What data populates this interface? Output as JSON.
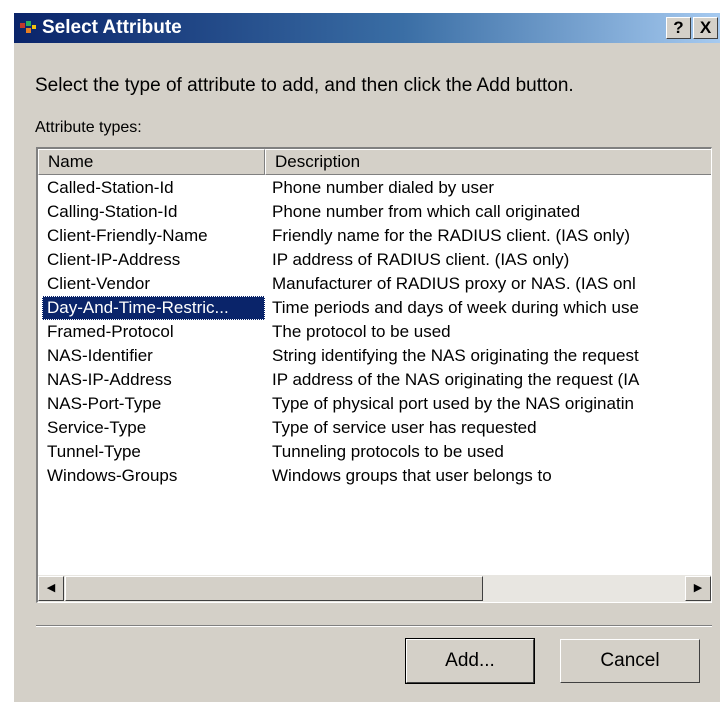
{
  "window": {
    "title": "Select Attribute",
    "help_label": "?",
    "close_label": "X"
  },
  "instruction": "Select the type of attribute to add, and then click the Add button.",
  "list_label": "Attribute types:",
  "columns": {
    "name": "Name",
    "description": "Description"
  },
  "rows": [
    {
      "name": "Called-Station-Id",
      "description": "Phone number dialed by user"
    },
    {
      "name": "Calling-Station-Id",
      "description": "Phone number from which call originated"
    },
    {
      "name": "Client-Friendly-Name",
      "description": "Friendly name for the RADIUS client. (IAS only)"
    },
    {
      "name": "Client-IP-Address",
      "description": "IP address of RADIUS client. (IAS only)"
    },
    {
      "name": "Client-Vendor",
      "description": "Manufacturer of RADIUS proxy or NAS. (IAS onl"
    },
    {
      "name": "Day-And-Time-Restric...",
      "description": "Time periods and days of week during which use"
    },
    {
      "name": "Framed-Protocol",
      "description": "The protocol to be used"
    },
    {
      "name": "NAS-Identifier",
      "description": "String identifying the NAS originating the request"
    },
    {
      "name": "NAS-IP-Address",
      "description": "IP address of the NAS originating the request (IA"
    },
    {
      "name": "NAS-Port-Type",
      "description": "Type of physical port used by the NAS originatin"
    },
    {
      "name": "Service-Type",
      "description": "Type of service user has requested"
    },
    {
      "name": "Tunnel-Type",
      "description": "Tunneling protocols to be used"
    },
    {
      "name": "Windows-Groups",
      "description": "Windows groups that user belongs to"
    }
  ],
  "selected_row": "Day-And-Time-Restric...",
  "scroll": {
    "left_arrow": "◀",
    "right_arrow": "▶"
  },
  "buttons": {
    "add": "Add...",
    "cancel": "Cancel"
  },
  "colors": {
    "titlebar_start": "#0a246a",
    "titlebar_end": "#a6caf0",
    "selection": "#0a246a",
    "dialog_face": "#d4d0c8"
  }
}
